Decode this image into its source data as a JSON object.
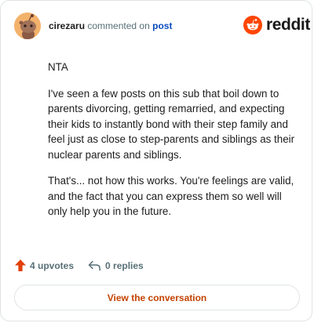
{
  "header": {
    "username": "cirezaru",
    "action_text": "commented on",
    "post_link": "post",
    "brand": "reddit"
  },
  "comment": {
    "paragraphs": [
      "NTA",
      "I've seen a few posts on this sub that boil down to parents divorcing, getting remarried, and expecting their kids to instantly bond with their step family and feel just as close to step-parents and siblings as their nuclear parents and siblings.",
      "That's... not how this works. You're feelings are valid, and the fact that you can express them so well will only help you in the future."
    ]
  },
  "actions": {
    "upvotes": "4 upvotes",
    "replies": "0 replies"
  },
  "cta": {
    "label": "View the conversation"
  },
  "colors": {
    "accent": "#ff4500",
    "link": "#0a4bbf",
    "cta_text": "#c44200"
  }
}
